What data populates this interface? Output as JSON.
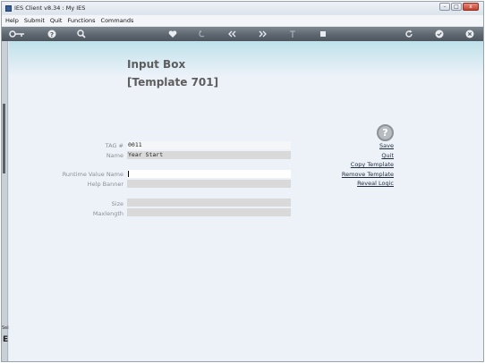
{
  "window": {
    "title": "IES Client v8.34 : My IES",
    "controls": {
      "minimize": "–",
      "maximize": "□",
      "close": "x"
    }
  },
  "menu": [
    "Help",
    "Submit",
    "Quit",
    "Functions",
    "Commands"
  ],
  "toolbar": {
    "icons": [
      "key-icon",
      "help-icon",
      "search-icon",
      "heart-icon",
      "undo-icon",
      "rewind-icon",
      "fast-forward-icon",
      "upload-icon",
      "stop-icon",
      "refresh-icon",
      "confirm-icon",
      "close-icon"
    ]
  },
  "left_panel": {
    "top_text": "Sei",
    "letter": "E"
  },
  "page": {
    "title": "Input Box",
    "subtitle": "[Template 701]"
  },
  "fields": {
    "tag": {
      "label": "TAG #",
      "value": "0011"
    },
    "name": {
      "label": "Name",
      "value": "Year Start"
    },
    "runtime_value_name": {
      "label": "Runtime Value Name",
      "value": ""
    },
    "help_banner": {
      "label": "Help Banner",
      "value": ""
    },
    "size": {
      "label": "Size",
      "value": ""
    },
    "maxlength": {
      "label": "Maxlength",
      "value": ""
    }
  },
  "actions": {
    "help_glyph": "?",
    "save": "Save",
    "quit": "Quit",
    "copy_template": "Copy Template",
    "remove_template": "Remove Template",
    "reveal_logic": "Reveal Logic"
  }
}
